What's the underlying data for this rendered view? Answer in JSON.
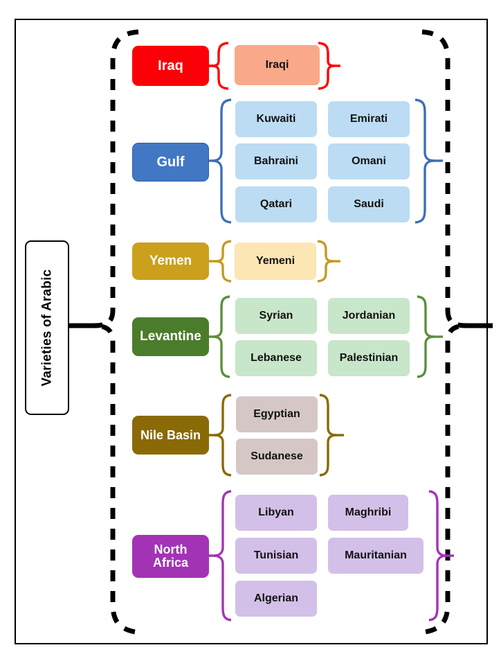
{
  "title_box": {
    "label": "Varieties of Arabic"
  },
  "colors": {
    "frame": "#000000",
    "outer_brace": "#000000",
    "iraq": "#FB0007",
    "iraq_dialect": "#F9A98A",
    "iraq_brace": "#FF0000",
    "gulf": "#4277C4",
    "gulf_border": "#2E5FA8",
    "gulf_dialect": "#BCDCF4",
    "gulf_brace": "#3D6FB5",
    "yemen": "#CBA01D",
    "yemen_dialect": "#FBE6B4",
    "yemen_brace": "#C59A20",
    "levantine": "#4B7C2B",
    "levantine_dialect": "#C8E6C9",
    "levantine_brace": "#5C8E3C",
    "nile": "#8A6A06",
    "nile_dialect": "#D6C7C7",
    "nile_brace": "#8A6A06",
    "northafrica": "#A333B5",
    "northafrica_dialect": "#D3C0E8",
    "northafrica_brace": "#A333B5"
  },
  "groups": [
    {
      "id": "iraq",
      "label": "Iraq",
      "dialects": [
        "Iraqi"
      ]
    },
    {
      "id": "gulf",
      "label": "Gulf",
      "dialects": [
        "Kuwaiti",
        "Emirati",
        "Bahraini",
        "Omani",
        "Qatari",
        "Saudi"
      ]
    },
    {
      "id": "yemen",
      "label": "Yemen",
      "dialects": [
        "Yemeni"
      ]
    },
    {
      "id": "levantine",
      "label": "Levantine",
      "dialects": [
        "Syrian",
        "Jordanian",
        "Lebanese",
        "Palestinian"
      ]
    },
    {
      "id": "nile",
      "label": "Nile Basin",
      "dialects": [
        "Egyptian",
        "Sudanese"
      ]
    },
    {
      "id": "northafrica",
      "label_line1": "North",
      "label_line2": "Africa",
      "dialects": [
        "Libyan",
        "Maghribi",
        "Tunisian",
        "Mauritanian",
        "Algerian"
      ]
    }
  ]
}
